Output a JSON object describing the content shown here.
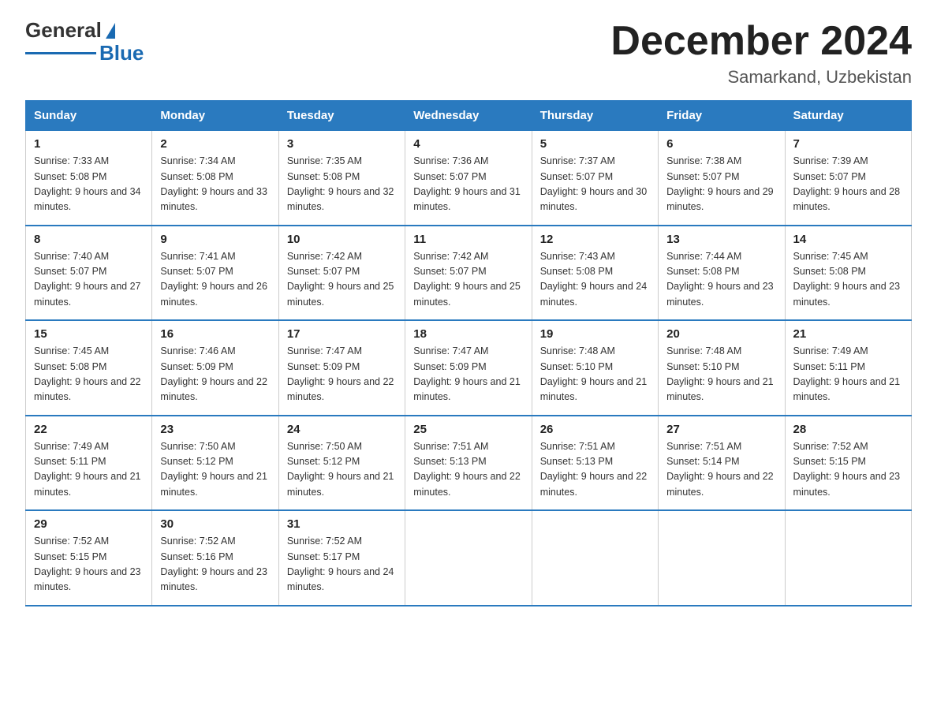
{
  "logo": {
    "general": "General",
    "blue": "Blue",
    "triangle": "▶"
  },
  "title": "December 2024",
  "subtitle": "Samarkand, Uzbekistan",
  "weekdays": [
    "Sunday",
    "Monday",
    "Tuesday",
    "Wednesday",
    "Thursday",
    "Friday",
    "Saturday"
  ],
  "weeks": [
    [
      {
        "day": "1",
        "sunrise": "7:33 AM",
        "sunset": "5:08 PM",
        "daylight": "9 hours and 34 minutes."
      },
      {
        "day": "2",
        "sunrise": "7:34 AM",
        "sunset": "5:08 PM",
        "daylight": "9 hours and 33 minutes."
      },
      {
        "day": "3",
        "sunrise": "7:35 AM",
        "sunset": "5:08 PM",
        "daylight": "9 hours and 32 minutes."
      },
      {
        "day": "4",
        "sunrise": "7:36 AM",
        "sunset": "5:07 PM",
        "daylight": "9 hours and 31 minutes."
      },
      {
        "day": "5",
        "sunrise": "7:37 AM",
        "sunset": "5:07 PM",
        "daylight": "9 hours and 30 minutes."
      },
      {
        "day": "6",
        "sunrise": "7:38 AM",
        "sunset": "5:07 PM",
        "daylight": "9 hours and 29 minutes."
      },
      {
        "day": "7",
        "sunrise": "7:39 AM",
        "sunset": "5:07 PM",
        "daylight": "9 hours and 28 minutes."
      }
    ],
    [
      {
        "day": "8",
        "sunrise": "7:40 AM",
        "sunset": "5:07 PM",
        "daylight": "9 hours and 27 minutes."
      },
      {
        "day": "9",
        "sunrise": "7:41 AM",
        "sunset": "5:07 PM",
        "daylight": "9 hours and 26 minutes."
      },
      {
        "day": "10",
        "sunrise": "7:42 AM",
        "sunset": "5:07 PM",
        "daylight": "9 hours and 25 minutes."
      },
      {
        "day": "11",
        "sunrise": "7:42 AM",
        "sunset": "5:07 PM",
        "daylight": "9 hours and 25 minutes."
      },
      {
        "day": "12",
        "sunrise": "7:43 AM",
        "sunset": "5:08 PM",
        "daylight": "9 hours and 24 minutes."
      },
      {
        "day": "13",
        "sunrise": "7:44 AM",
        "sunset": "5:08 PM",
        "daylight": "9 hours and 23 minutes."
      },
      {
        "day": "14",
        "sunrise": "7:45 AM",
        "sunset": "5:08 PM",
        "daylight": "9 hours and 23 minutes."
      }
    ],
    [
      {
        "day": "15",
        "sunrise": "7:45 AM",
        "sunset": "5:08 PM",
        "daylight": "9 hours and 22 minutes."
      },
      {
        "day": "16",
        "sunrise": "7:46 AM",
        "sunset": "5:09 PM",
        "daylight": "9 hours and 22 minutes."
      },
      {
        "day": "17",
        "sunrise": "7:47 AM",
        "sunset": "5:09 PM",
        "daylight": "9 hours and 22 minutes."
      },
      {
        "day": "18",
        "sunrise": "7:47 AM",
        "sunset": "5:09 PM",
        "daylight": "9 hours and 21 minutes."
      },
      {
        "day": "19",
        "sunrise": "7:48 AM",
        "sunset": "5:10 PM",
        "daylight": "9 hours and 21 minutes."
      },
      {
        "day": "20",
        "sunrise": "7:48 AM",
        "sunset": "5:10 PM",
        "daylight": "9 hours and 21 minutes."
      },
      {
        "day": "21",
        "sunrise": "7:49 AM",
        "sunset": "5:11 PM",
        "daylight": "9 hours and 21 minutes."
      }
    ],
    [
      {
        "day": "22",
        "sunrise": "7:49 AM",
        "sunset": "5:11 PM",
        "daylight": "9 hours and 21 minutes."
      },
      {
        "day": "23",
        "sunrise": "7:50 AM",
        "sunset": "5:12 PM",
        "daylight": "9 hours and 21 minutes."
      },
      {
        "day": "24",
        "sunrise": "7:50 AM",
        "sunset": "5:12 PM",
        "daylight": "9 hours and 21 minutes."
      },
      {
        "day": "25",
        "sunrise": "7:51 AM",
        "sunset": "5:13 PM",
        "daylight": "9 hours and 22 minutes."
      },
      {
        "day": "26",
        "sunrise": "7:51 AM",
        "sunset": "5:13 PM",
        "daylight": "9 hours and 22 minutes."
      },
      {
        "day": "27",
        "sunrise": "7:51 AM",
        "sunset": "5:14 PM",
        "daylight": "9 hours and 22 minutes."
      },
      {
        "day": "28",
        "sunrise": "7:52 AM",
        "sunset": "5:15 PM",
        "daylight": "9 hours and 23 minutes."
      }
    ],
    [
      {
        "day": "29",
        "sunrise": "7:52 AM",
        "sunset": "5:15 PM",
        "daylight": "9 hours and 23 minutes."
      },
      {
        "day": "30",
        "sunrise": "7:52 AM",
        "sunset": "5:16 PM",
        "daylight": "9 hours and 23 minutes."
      },
      {
        "day": "31",
        "sunrise": "7:52 AM",
        "sunset": "5:17 PM",
        "daylight": "9 hours and 24 minutes."
      },
      null,
      null,
      null,
      null
    ]
  ],
  "colors": {
    "header_bg": "#2a7abf",
    "header_text": "#ffffff",
    "border": "#2a7abf"
  }
}
